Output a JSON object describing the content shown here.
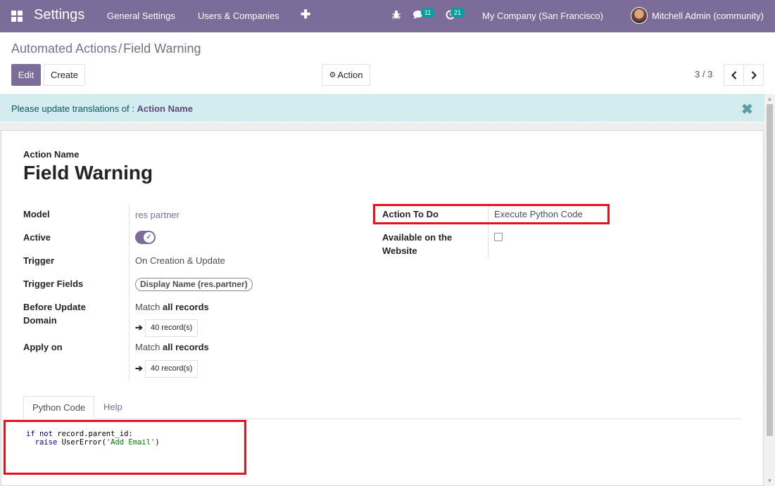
{
  "navbar": {
    "brand": "Settings",
    "menus": [
      "General Settings",
      "Users & Companies"
    ],
    "add_icon": "plus-icon",
    "messages_count": "11",
    "activities_count": "21",
    "company": "My Company (San Francisco)",
    "user": "Mitchell Admin (community)"
  },
  "breadcrumb": {
    "parent": "Automated Actions",
    "separator": "/",
    "current": "Field Warning"
  },
  "toolbar": {
    "edit": "Edit",
    "create": "Create",
    "action": "Action",
    "pager": "3 / 3"
  },
  "alert": {
    "prefix": "Please update translations of :",
    "field": "Action Name"
  },
  "form": {
    "name_label": "Action Name",
    "name": "Field Warning",
    "model_label": "Model",
    "model": "res partner",
    "active_label": "Active",
    "active": true,
    "trigger_label": "Trigger",
    "trigger": "On Creation & Update",
    "trigger_fields_label": "Trigger Fields",
    "trigger_fields_tag": "Display Name (res.partner)",
    "before_domain_label_1": "Before Update",
    "before_domain_label_2": "Domain",
    "match_prefix": "Match",
    "match_all": "all records",
    "records_button": "40 record(s)",
    "apply_on_label": "Apply on",
    "action_to_do_label": "Action To Do",
    "action_to_do": "Execute Python Code",
    "website_label_1": "Available on the",
    "website_label_2": "Website",
    "website_available": false
  },
  "tabs": {
    "python_code": "Python Code",
    "help": "Help"
  },
  "code": {
    "line1_kw": "if not",
    "line1_rest": " record.parent_id:",
    "line2_kw": "raise",
    "line2_fn": " UserError(",
    "line2_str": "'Add Email'",
    "line2_end": ")"
  },
  "colors": {
    "brand": "#7c6c99",
    "highlight": "#e8101c",
    "badge": "#00a09d"
  }
}
